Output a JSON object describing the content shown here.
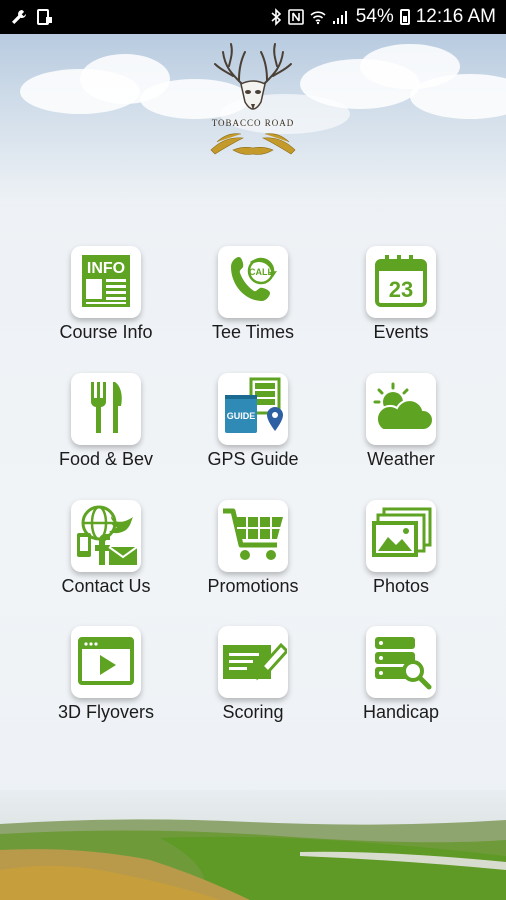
{
  "status_bar": {
    "left_icons": [
      "wrench-icon",
      "tablet-icon"
    ],
    "right_icons": [
      "bluetooth-icon",
      "nfc-icon",
      "wifi-icon",
      "signal-icon"
    ],
    "battery": "54%",
    "time": "12:16 AM"
  },
  "logo": {
    "text": "TOBACCO ROAD"
  },
  "menu": {
    "items": [
      {
        "label": "Course Info",
        "icon": "info-newspaper-icon"
      },
      {
        "label": "Tee Times",
        "icon": "phone-call-icon"
      },
      {
        "label": "Events",
        "icon": "calendar-icon"
      },
      {
        "label": "Food & Bev",
        "icon": "fork-knife-icon"
      },
      {
        "label": "GPS Guide",
        "icon": "gps-guide-icon"
      },
      {
        "label": "Weather",
        "icon": "sun-cloud-icon"
      },
      {
        "label": "Contact Us",
        "icon": "contact-social-icon"
      },
      {
        "label": "Promotions",
        "icon": "shopping-cart-icon"
      },
      {
        "label": "Photos",
        "icon": "photos-icon"
      },
      {
        "label": "3D Flyovers",
        "icon": "video-play-icon"
      },
      {
        "label": "Scoring",
        "icon": "scorecard-pencil-icon"
      },
      {
        "label": "Handicap",
        "icon": "database-search-icon"
      }
    ]
  },
  "colors": {
    "accent_green": "#5fa322",
    "status_bar": "#000000"
  }
}
